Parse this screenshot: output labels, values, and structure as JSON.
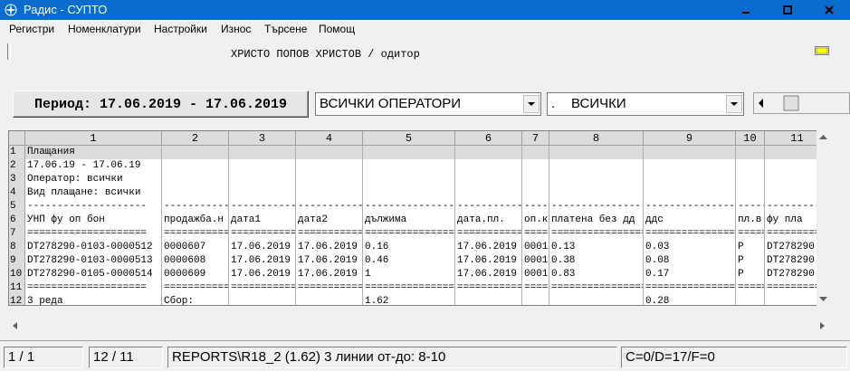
{
  "window": {
    "title": "Радис - СУПТО"
  },
  "menu": [
    "Регистри",
    "Номенклатури",
    "Настройки",
    "Износ",
    "Търсене",
    "Помощ"
  ],
  "info": {
    "person": "ХРИСТО ПОПОВ ХРИСТОВ / одитор"
  },
  "toolbar": {
    "period_label": "Период: 17.06.2019 - 17.06.2019",
    "operator_value": "ВСИЧКИ ОПЕРАТОРИ",
    "filter_dot": ".",
    "filter_value": "ВСИЧКИ"
  },
  "grid": {
    "col_headers": [
      "1",
      "2",
      "3",
      "4",
      "5",
      "6",
      "7",
      "8",
      "9",
      "10",
      "11"
    ],
    "row_headers": [
      "1",
      "2",
      "3",
      "4",
      "5",
      "6",
      "7",
      "8",
      "9",
      "10",
      "11",
      "12"
    ],
    "rows": [
      [
        "Плащания",
        "",
        "",
        "",
        "",
        "",
        "",
        "",
        "",
        "",
        ""
      ],
      [
        "17.06.19 - 17.06.19",
        "",
        "",
        "",
        "",
        "",
        "",
        "",
        "",
        "",
        ""
      ],
      [
        "Оператор: всички",
        "",
        "",
        "",
        "",
        "",
        "",
        "",
        "",
        "",
        ""
      ],
      [
        "Вид плащане: всички",
        "",
        "",
        "",
        "",
        "",
        "",
        "",
        "",
        "",
        ""
      ],
      [
        "--------------------",
        "---------------",
        "--------------",
        "--------------",
        "--------------------",
        "--------------",
        "------",
        "--------------------",
        "--------------------",
        "-----",
        "----------"
      ],
      [
        "УНП фу оп бон",
        "продажба.н",
        "дата1",
        "дата2",
        "дължима",
        "дата.пл.",
        "оп.к",
        "платена без дд",
        "ддс",
        "пл.в",
        "фу пла"
      ],
      [
        "====================",
        "===============",
        "==============",
        "==============",
        "====================",
        "==============",
        "======",
        "====================",
        "====================",
        "=====",
        "=========="
      ],
      [
        "DT278290-0103-0000512",
        "0000607",
        "17.06.2019",
        "17.06.2019",
        "0.16",
        "17.06.2019",
        "0001",
        "0.13",
        "0.03",
        "P",
        "DT278290"
      ],
      [
        "DT278290-0103-0000513",
        "0000608",
        "17.06.2019",
        "17.06.2019",
        "0.46",
        "17.06.2019",
        "0001",
        "0.38",
        "0.08",
        "P",
        "DT278290"
      ],
      [
        "DT278290-0105-0000514",
        "0000609",
        "17.06.2019",
        "17.06.2019",
        "1",
        "17.06.2019",
        "0001",
        "0.83",
        "0.17",
        "P",
        "DT278290"
      ],
      [
        "====================",
        "===============",
        "==============",
        "==============",
        "====================",
        "==============",
        "======",
        "====================",
        "====================",
        "=====",
        "=========="
      ],
      [
        "3 реда",
        " Сбор:",
        "",
        "",
        "1.62",
        "",
        "",
        "",
        "0.28",
        "",
        ""
      ]
    ]
  },
  "status": {
    "page": "1 / 1",
    "rows": "12 / 11",
    "report": "REPORTS\\R18_2 (1.62) 3 линии от-до: 8-10",
    "flags": "C=0/D=17/F=0"
  },
  "colors": {
    "titlebar": "#0a6ccc",
    "header_bg": "#dcdcdc",
    "indicator": "#ffff00"
  }
}
